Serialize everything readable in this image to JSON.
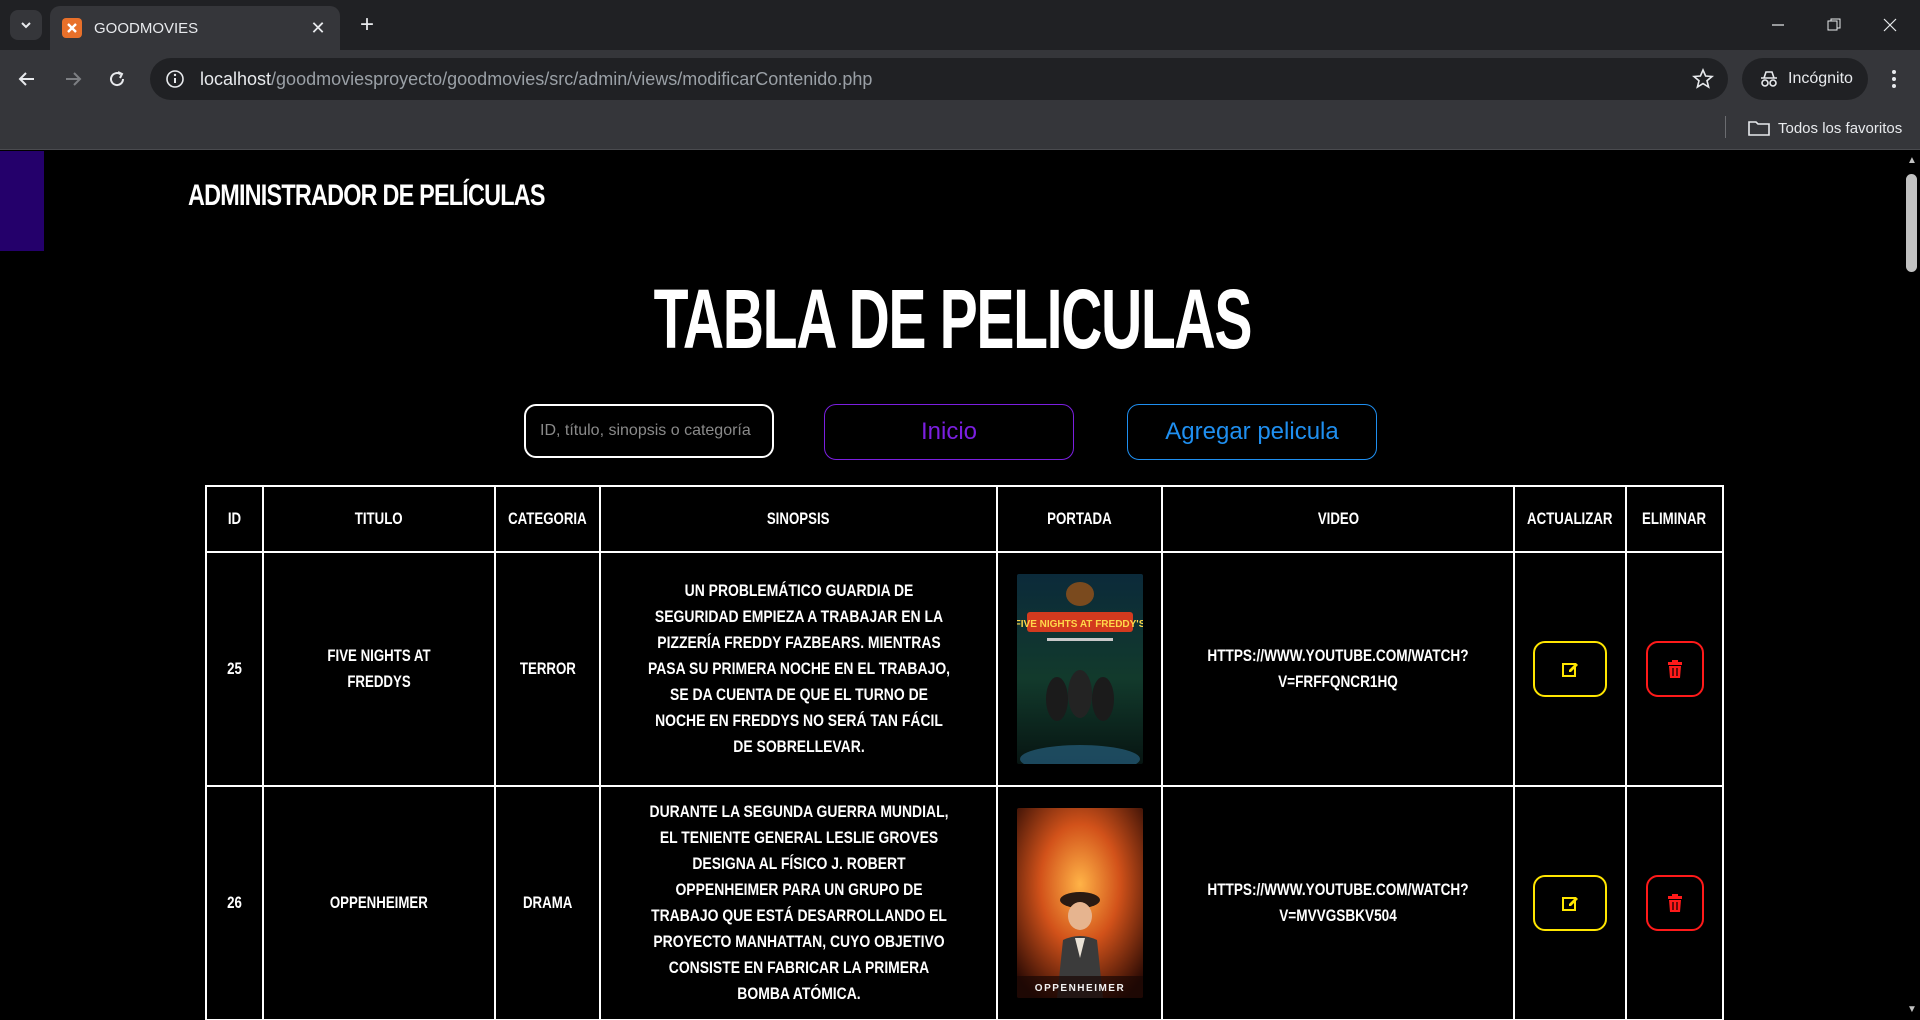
{
  "browser": {
    "tab_title": "GOODMOVIES",
    "url_host": "localhost",
    "url_path": "/goodmoviesproyecto/goodmovies/src/admin/views/modificarContenido.php",
    "incognito_label": "Incógnito",
    "bookmarks_label": "Todos los favoritos"
  },
  "header": {
    "admin_title": "ADMINISTRADOR DE PELÍCULAS",
    "page_title": "TABLA DE PELICULAS"
  },
  "controls": {
    "search_placeholder": "ID, título, sinopsis o categoría",
    "inicio_label": "Inicio",
    "agregar_label": "Agregar pelicula"
  },
  "table": {
    "columns": [
      "ID",
      "TITULO",
      "CATEGORIA",
      "SINOPSIS",
      "PORTADA",
      "VIDEO",
      "ACTUALIZAR",
      "ELIMINAR"
    ],
    "rows": [
      {
        "id": "25",
        "titulo": "FIVE NIGHTS AT FREDDYS",
        "categoria": "TERROR",
        "sinopsis": "UN PROBLEMÁTICO GUARDIA DE SEGURIDAD EMPIEZA A TRABAJAR EN LA PIZZERÍA FREDDY FAZBEARS. MIENTRAS PASA SU PRIMERA NOCHE EN EL TRABAJO, SE DA CUENTA DE QUE EL TURNO DE NOCHE EN FREDDYS NO SERÁ TAN FÁCIL DE SOBRELLEVAR.",
        "poster_text": "FIVE NIGHTS AT FREDDY'S",
        "video": "HTTPS://WWW.YOUTUBE.COM/WATCH?V=FRFFQNCR1HQ"
      },
      {
        "id": "26",
        "titulo": "OPPENHEIMER",
        "categoria": "DRAMA",
        "sinopsis": "DURANTE LA SEGUNDA GUERRA MUNDIAL, EL TENIENTE GENERAL LESLIE GROVES DESIGNA AL FÍSICO J. ROBERT OPPENHEIMER PARA UN GRUPO DE TRABAJO QUE ESTÁ DESARROLLANDO EL PROYECTO MANHATTAN, CUYO OBJETIVO CONSISTE EN FABRICAR LA PRIMERA BOMBA ATÓMICA.",
        "poster_text": "OPPENHEIMER",
        "video": "HTTPS://WWW.YOUTUBE.COM/WATCH?V=MVVGSBKV504"
      }
    ]
  },
  "colors": {
    "inicio": "#7b1fe0",
    "agregar": "#1f8ff0",
    "actualizar": "#ffe600",
    "eliminar": "#ff1a1a",
    "side_accent": "#24006b"
  },
  "icons": {
    "actualizar": "edit-icon",
    "eliminar": "trash-icon"
  }
}
